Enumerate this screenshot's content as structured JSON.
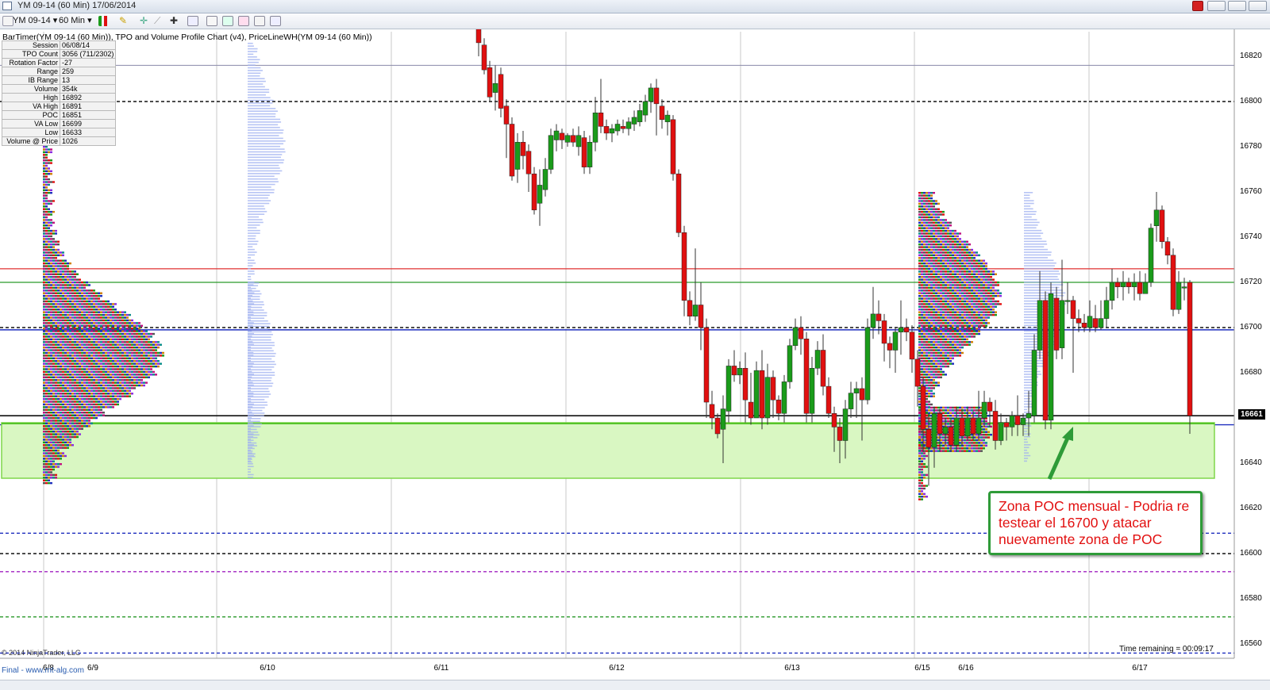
{
  "window": {
    "title": "YM 09-14 (60 Min)  17/06/2014"
  },
  "toolbar": {
    "instrument": "YM 09-14",
    "interval": "60 Min"
  },
  "indicators_line": "BarTimer(YM 09-14 (60 Min)), TPO and Volume Profile Chart (v4), PriceLineWH(YM 09-14 (60 Min))",
  "session_info": [
    {
      "label": "Session",
      "value": "06/08/14"
    },
    {
      "label": "TPO Count",
      "value": "3056 (711/2302)"
    },
    {
      "label": "Rotation Factor",
      "value": "-27"
    },
    {
      "label": "Range",
      "value": "259"
    },
    {
      "label": "IB Range",
      "value": "13"
    },
    {
      "label": "Volume",
      "value": "354k"
    },
    {
      "label": "High",
      "value": "16892"
    },
    {
      "label": "VA High",
      "value": "16891"
    },
    {
      "label": "POC",
      "value": "16851"
    },
    {
      "label": "VA Low",
      "value": "16699"
    },
    {
      "label": "Low",
      "value": "16633"
    },
    {
      "label": "Volume @ Price",
      "value": "1026"
    }
  ],
  "y_axis": {
    "labels": [
      "16820",
      "16800",
      "16780",
      "16760",
      "16740",
      "16720",
      "16700",
      "16680",
      "16661",
      "16640",
      "16620",
      "16600",
      "16580",
      "16560"
    ],
    "current_price": "16661"
  },
  "x_axis": {
    "labels": [
      "6/8",
      "6/9",
      "6/10",
      "6/11",
      "6/12",
      "6/13",
      "6/15",
      "6/16",
      "6/17"
    ]
  },
  "annotation": {
    "text": "Zona POC mensual - Podria re testear el 16700 y atacar nuevamente zona de POC"
  },
  "footer": {
    "copyright": "© 2014 NinjaTrader, LLC",
    "link": "Final - www.mt-alg.com",
    "time_remaining": "Time remaining = 00:09:17"
  },
  "colors": {
    "up_candle": "#1a9b1a",
    "down_candle": "#e01010",
    "poc_zone": "#d9f7c2",
    "poc_zone_border": "#7fd64a",
    "annotation_border": "#2e9b38",
    "annotation_text": "#e21010"
  }
}
